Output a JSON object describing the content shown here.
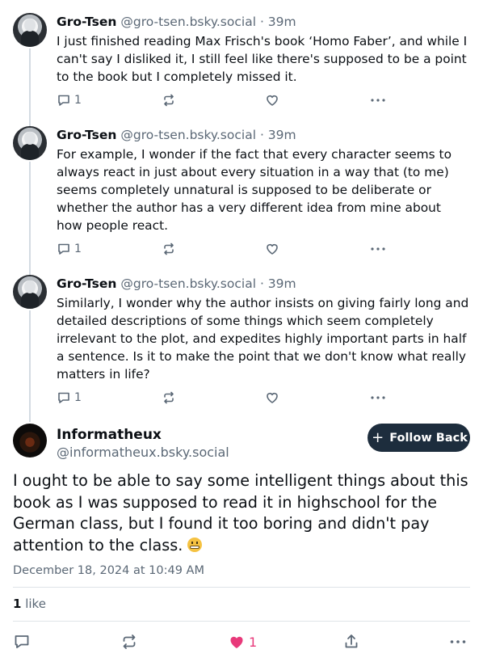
{
  "thread": [
    {
      "author": "Gro-Tsen",
      "handle": "@gro-tsen.bsky.social",
      "age": "· 39m",
      "text": "I just finished reading Max Frisch's book ‘Homo Faber’, and while I can't say I disliked it, I still feel like there's supposed to be a point to the book but I completely missed it.",
      "replies": "1"
    },
    {
      "author": "Gro-Tsen",
      "handle": "@gro-tsen.bsky.social",
      "age": "· 39m",
      "text": "For example, I wonder if the fact that every character seems to always react in just about every situation in a way that (to me) seems completely unnatural is supposed to be deliberate or whether the author has a very different idea from mine about how people react.",
      "replies": "1"
    },
    {
      "author": "Gro-Tsen",
      "handle": "@gro-tsen.bsky.social",
      "age": "· 39m",
      "text": "Similarly, I wonder why the author insists on giving fairly long and detailed descriptions of some things which seem completely irrelevant to the plot, and expedites highly important parts in half a sentence. Is it to make the point that we don't know what really matters in life?",
      "replies": "1"
    }
  ],
  "main_post": {
    "author": "Informatheux",
    "handle": "@informatheux.bsky.social",
    "follow_label": "Follow Back",
    "text": "I ought to be able to say some intelligent things about this book as I was supposed to read it in highschool for the German class, but I found it too boring and didn't pay attention to the class.",
    "emoji": "grimacing-face",
    "timestamp": "December 18, 2024 at 10:49 AM",
    "like_count": "1",
    "like_word": "like",
    "liked_count": "1"
  },
  "colors": {
    "muted": "#5b6876",
    "follow_button": "#1d2d3d",
    "like_active": "#e8397a",
    "thread_line": "#d4dbe2"
  }
}
